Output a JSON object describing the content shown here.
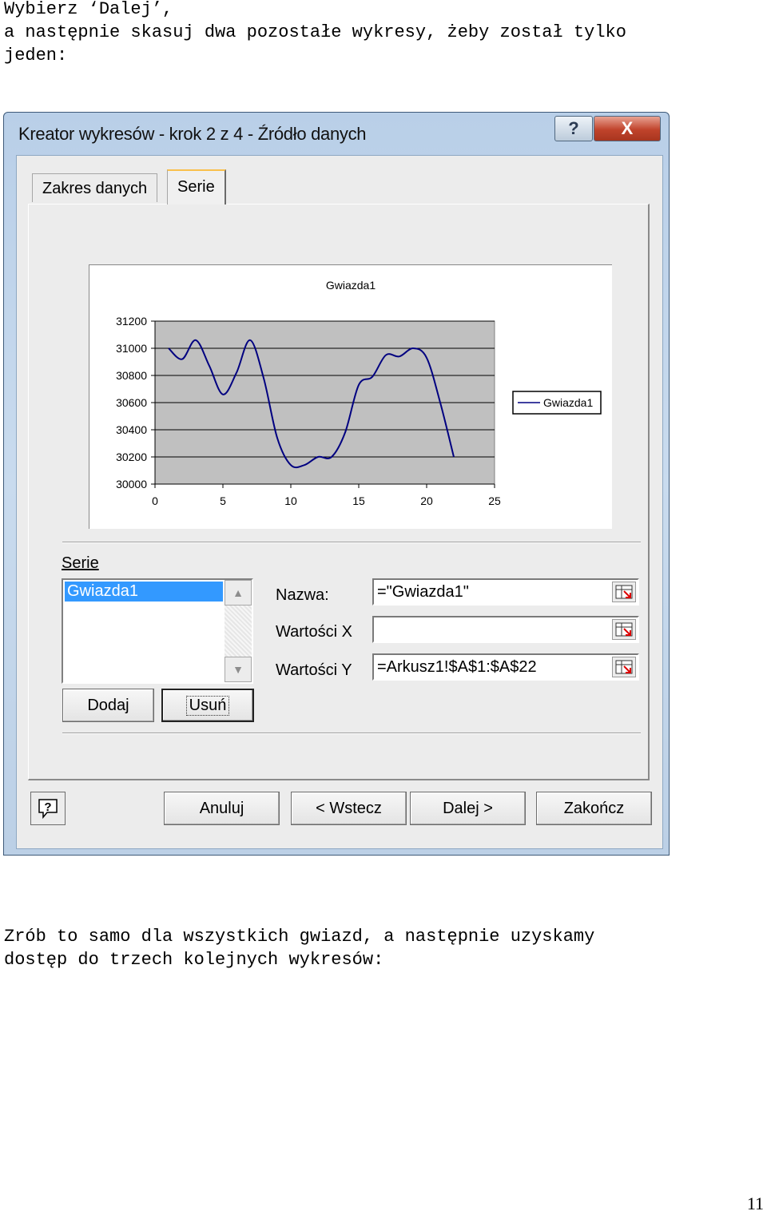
{
  "doc": {
    "intro_line1": "Wybierz ‘Dalej’,",
    "intro_line2": "a następnie skasuj dwa pozostałe wykresy, żeby został tylko",
    "intro_line3": "jeden:",
    "outro_line1": "Zrób to samo dla wszystkich gwiazd, a następnie uzyskamy",
    "outro_line2": "dostęp do trzech kolejnych wykresów:",
    "page_number": "11"
  },
  "dialog": {
    "title": "Kreator wykresów - krok 2 z 4 - Źródło danych",
    "title_buttons": {
      "help": "?",
      "close": "X"
    },
    "tabs": [
      {
        "label": "Zakres danych",
        "active": false
      },
      {
        "label": "Serie",
        "active": true
      }
    ],
    "series_section": {
      "label": "Serie",
      "items": [
        "Gwiazda1"
      ],
      "selected": "Gwiazda1",
      "add_label": "Dodaj",
      "remove_label": "Usuń"
    },
    "fields": {
      "name_label": "Nazwa:",
      "name_value": "=\"Gwiazda1\"",
      "x_label": "Wartości X",
      "x_value": "",
      "y_label": "Wartości Y",
      "y_value": "=Arkusz1!$A$1:$A$22"
    },
    "buttons": {
      "cancel": "Anuluj",
      "back": "< Wstecz",
      "next": "Dalej >",
      "finish": "Zakończ"
    },
    "icons": {
      "help": "help-icon",
      "range_picker": "range-picker-icon"
    }
  },
  "chart_data": {
    "type": "line",
    "title": "Gwiazda1",
    "xlabel": "",
    "ylabel": "",
    "x_ticks": [
      0,
      5,
      10,
      15,
      20,
      25
    ],
    "y_ticks": [
      30000,
      30200,
      30400,
      30600,
      30800,
      31000,
      31200
    ],
    "xlim": [
      0,
      25
    ],
    "ylim": [
      30000,
      31200
    ],
    "grid": true,
    "legend_position": "right",
    "colors": {
      "plot_bg": "#c0c0c0",
      "line": "#000080"
    },
    "series": [
      {
        "name": "Gwiazda1",
        "x": [
          1,
          2,
          3,
          4,
          5,
          6,
          7,
          8,
          9,
          10,
          11,
          12,
          13,
          14,
          15,
          16,
          17,
          18,
          19,
          20,
          21,
          22
        ],
        "values": [
          31000,
          30920,
          31060,
          30870,
          30660,
          30820,
          31060,
          30780,
          30340,
          30140,
          30140,
          30200,
          30200,
          30380,
          30730,
          30790,
          30950,
          30940,
          31000,
          30930,
          30600,
          30200
        ]
      }
    ]
  }
}
